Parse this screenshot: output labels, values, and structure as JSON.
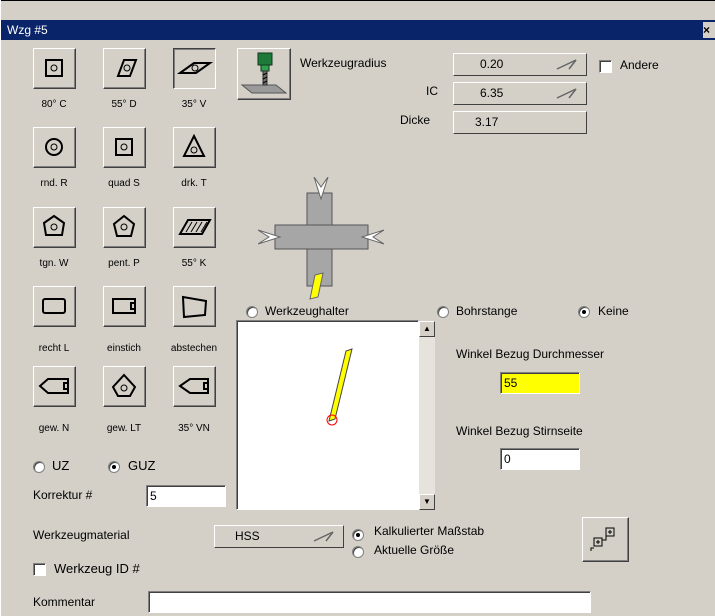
{
  "window": {
    "title": "Wzg #5",
    "close_label": "×"
  },
  "tools": [
    {
      "label": "80° C",
      "icon": "insert-80c-icon"
    },
    {
      "label": "55° D",
      "icon": "insert-55d-icon"
    },
    {
      "label": "35° V",
      "icon": "insert-35v-icon",
      "pressed": true
    },
    {
      "label": "rnd. R",
      "icon": "insert-round-icon"
    },
    {
      "label": "quad S",
      "icon": "insert-square-icon"
    },
    {
      "label": "drk. T",
      "icon": "insert-triangle-icon"
    },
    {
      "label": "tgn. W",
      "icon": "insert-trigon-icon"
    },
    {
      "label": "pent. P",
      "icon": "insert-pentagon-icon"
    },
    {
      "label": "55° K",
      "icon": "insert-55k-icon"
    },
    {
      "label": "recht L",
      "icon": "insert-rect-icon"
    },
    {
      "label": "einstich",
      "icon": "insert-groove-icon"
    },
    {
      "label": "abstechen",
      "icon": "insert-partoff-icon"
    },
    {
      "label": "gew. N",
      "icon": "insert-thread-n-icon"
    },
    {
      "label": "gew. LT",
      "icon": "insert-thread-lt-icon"
    },
    {
      "label": "35° VN",
      "icon": "insert-35vn-icon"
    }
  ],
  "params": {
    "radius_label": "Werkzeugradius",
    "radius_value": "0.20",
    "ic_label": "IC",
    "ic_value": "6.35",
    "thickness_label": "Dicke",
    "thickness_value": "3.17",
    "other_label": "Andere"
  },
  "holder_options": {
    "holder": "Werkzeughalter",
    "boring_bar": "Bohrstange",
    "none": "Keine",
    "selected": "none"
  },
  "angles": {
    "diameter_label": "Winkel Bezug Durchmesser",
    "diameter_value": "55",
    "face_label": "Winkel Bezug Stirnseite",
    "face_value": "0"
  },
  "direction": {
    "uz": "UZ",
    "guz": "GUZ",
    "selected": "guz"
  },
  "correction": {
    "label": "Korrektur #",
    "value": "5"
  },
  "material": {
    "label": "Werkzeugmaterial",
    "value": "HSS"
  },
  "scale": {
    "calculated": "Kalkulierter Maßstab",
    "actual": "Aktuelle Größe",
    "selected": "calculated"
  },
  "tool_id": {
    "label": "Werkzeug ID #"
  },
  "comment": {
    "label": "Kommentar",
    "value": ""
  },
  "colors": {
    "title_bar": "#0a246a",
    "insert_fill": "#ffff00",
    "highlight_field": "#ffff00",
    "marker": "#ff0000"
  }
}
